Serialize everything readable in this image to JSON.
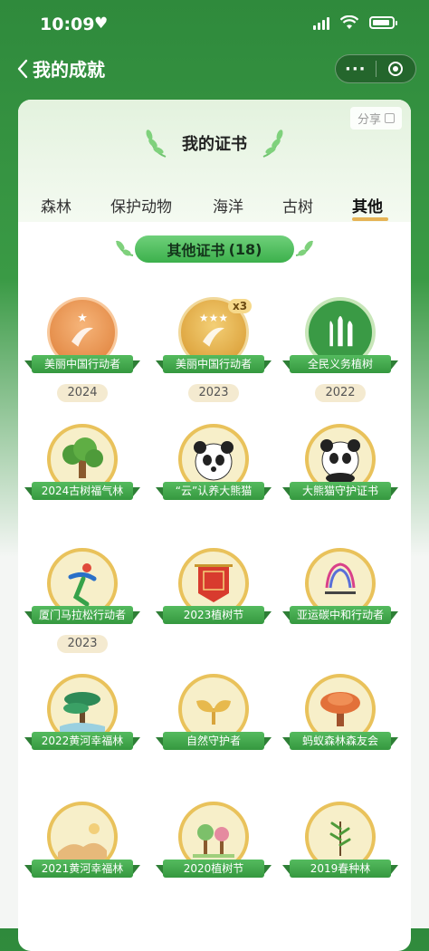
{
  "status_bar": {
    "time": "10:09"
  },
  "nav": {
    "back_title": "我的成就",
    "more_label": "···"
  },
  "card": {
    "share_label": "分享",
    "heading": "我的证书",
    "tabs": [
      "森林",
      "保护动物",
      "海洋",
      "古树",
      "其他"
    ],
    "active_tab_index": 4,
    "section_title": "其他证书",
    "section_count": "(18)"
  },
  "colors": {
    "brand_green": "#3a9a45",
    "accent_gold": "#e6b355"
  },
  "badges": [
    {
      "label": "美丽中国行动者",
      "year": "2024",
      "icon": "medal-bronze-icon"
    },
    {
      "label": "美丽中国行动者",
      "year": "2023",
      "count": "x3",
      "icon": "medal-gold-icon"
    },
    {
      "label": "全民义务植树",
      "year": "2022",
      "icon": "tree-seal-icon"
    },
    {
      "label": "2024古树福气林",
      "icon": "old-tree-icon"
    },
    {
      "label": "“云”认养大熊猫",
      "icon": "panda-icon"
    },
    {
      "label": "大熊猫守护证书",
      "icon": "panda-icon"
    },
    {
      "label": "厦门马拉松行动者",
      "year": "2023",
      "icon": "runner-icon"
    },
    {
      "label": "2023植树节",
      "icon": "banner-flag-icon"
    },
    {
      "label": "亚运碳中和行动者",
      "icon": "asian-games-icon"
    },
    {
      "label": "2022黄河幸福林",
      "icon": "pine-tree-icon"
    },
    {
      "label": "自然守护者",
      "icon": "sprout-icon"
    },
    {
      "label": "蚂蚁森林森友会",
      "icon": "mushroom-tree-icon"
    },
    {
      "label": "2021黄河幸福林",
      "icon": "desert-tree-icon"
    },
    {
      "label": "2020植树节",
      "icon": "trees-icon"
    },
    {
      "label": "2019春种林",
      "icon": "sapling-icon"
    }
  ]
}
